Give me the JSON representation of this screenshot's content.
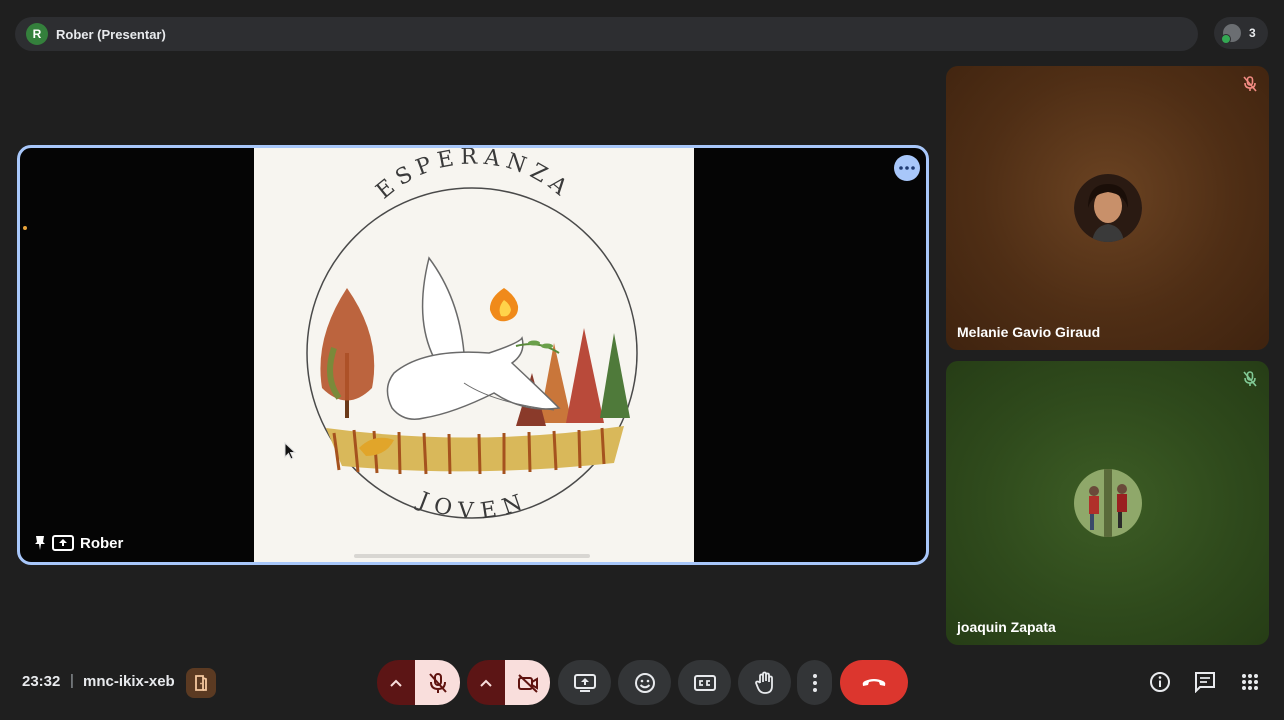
{
  "topbar": {
    "presenter_initial": "R",
    "presenter_label": "Rober (Presentar)",
    "participant_count": "3"
  },
  "main_tile": {
    "presenter_name": "Rober",
    "slide": {
      "title_top": "ESPERANZA",
      "title_bottom": "JOVEN"
    }
  },
  "participants": [
    {
      "name": "Melanie Gavio Giraud",
      "muted": true
    },
    {
      "name": "joaquin Zapata",
      "muted": true
    }
  ],
  "footer": {
    "time": "23:32",
    "separator": "|",
    "meeting_code": "mnc-ikix-xeb"
  },
  "controls": {
    "mic": "off",
    "camera": "off"
  },
  "colors": {
    "background": "#1f1f1f",
    "accent_border": "#a8c7fa",
    "end_call": "#dc362e",
    "muted_control": "#f9dedc",
    "muted_arrow": "#5c1515"
  }
}
